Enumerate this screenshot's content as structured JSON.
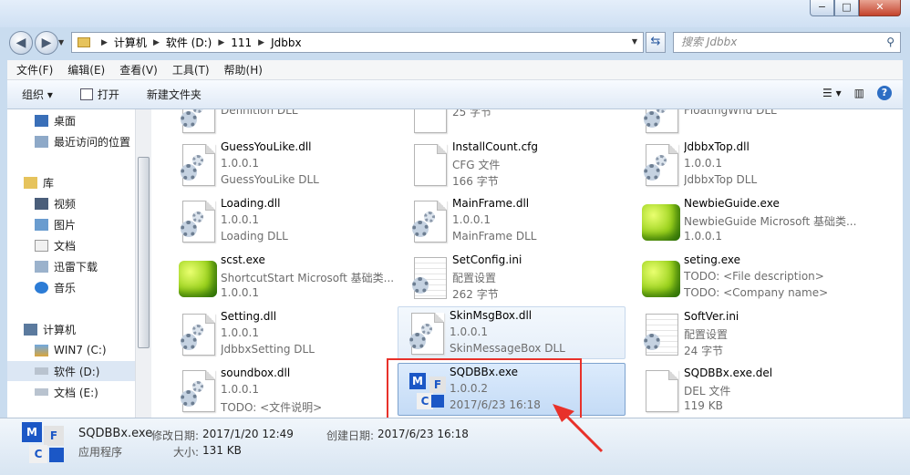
{
  "window": {
    "minimize": "−",
    "maximize": "□",
    "close": "✕"
  },
  "nav": {
    "back": "◀",
    "forward": "▶"
  },
  "address": {
    "crumbs": [
      "计算机",
      "软件 (D:)",
      "111",
      "Jdbbx"
    ]
  },
  "search": {
    "placeholder": "搜索 Jdbbx"
  },
  "menu": [
    "文件(F)",
    "编辑(E)",
    "查看(V)",
    "工具(T)",
    "帮助(H)"
  ],
  "toolbar": {
    "organize": "组织 ▾",
    "open": "打开",
    "new_folder": "新建文件夹"
  },
  "sidebar": {
    "items": [
      {
        "label": "桌面",
        "icon": "desktop-icon"
      },
      {
        "label": "最近访问的位置",
        "icon": "recent-places-icon"
      },
      {
        "label": "库",
        "icon": "library-icon"
      },
      {
        "label": "视频",
        "icon": "video-icon"
      },
      {
        "label": "图片",
        "icon": "pictures-icon"
      },
      {
        "label": "文档",
        "icon": "documents-icon"
      },
      {
        "label": "迅雷下载",
        "icon": "thunder-download-icon"
      },
      {
        "label": "音乐",
        "icon": "music-icon"
      },
      {
        "label": "计算机",
        "icon": "computer-icon"
      },
      {
        "label": "WIN7 (C:)",
        "icon": "drive-c-icon"
      },
      {
        "label": "软件 (D:)",
        "icon": "drive-d-icon"
      },
      {
        "label": "文档 (E:)",
        "icon": "drive-e-icon"
      }
    ]
  },
  "files": [
    {
      "name": "",
      "l2": "Definition DLL",
      "l3": "",
      "icon": "dll"
    },
    {
      "name": "",
      "l2": "25 字节",
      "l3": "",
      "icon": "doc"
    },
    {
      "name": "",
      "l2": "FloatingWnd DLL",
      "l3": "",
      "icon": "dll"
    },
    {
      "name": "GuessYouLike.dll",
      "l2": "1.0.0.1",
      "l3": "GuessYouLike DLL",
      "icon": "dll"
    },
    {
      "name": "InstallCount.cfg",
      "l2": "CFG 文件",
      "l3": "166 字节",
      "icon": "doc"
    },
    {
      "name": "JdbbxTop.dll",
      "l2": "1.0.0.1",
      "l3": "JdbbxTop DLL",
      "icon": "dll"
    },
    {
      "name": "Loading.dll",
      "l2": "1.0.0.1",
      "l3": "Loading DLL",
      "icon": "dll"
    },
    {
      "name": "MainFrame.dll",
      "l2": "1.0.0.1",
      "l3": "MainFrame DLL",
      "icon": "dll"
    },
    {
      "name": "NewbieGuide.exe",
      "l2": "NewbieGuide Microsoft 基础类...",
      "l3": "1.0.0.1",
      "icon": "cube"
    },
    {
      "name": "scst.exe",
      "l2": "ShortcutStart Microsoft 基础类...",
      "l3": "1.0.0.1",
      "icon": "cube"
    },
    {
      "name": "SetConfig.ini",
      "l2": "配置设置",
      "l3": "262 字节",
      "icon": "cfg"
    },
    {
      "name": "seting.exe",
      "l2": "TODO: <File description>",
      "l3": "TODO: <Company name>",
      "icon": "cube"
    },
    {
      "name": "Setting.dll",
      "l2": "1.0.0.1",
      "l3": "JdbbxSetting DLL",
      "icon": "dll"
    },
    {
      "name": "SkinMsgBox.dll",
      "l2": "1.0.0.1",
      "l3": "SkinMessageBox DLL",
      "icon": "dll"
    },
    {
      "name": "SoftVer.ini",
      "l2": "配置设置",
      "l3": "24 字节",
      "icon": "cfg"
    },
    {
      "name": "soundbox.dll",
      "l2": "1.0.0.1",
      "l3": "TODO: <文件说明>",
      "icon": "dll"
    },
    {
      "name": "SQDBBx.exe",
      "l2": "1.0.0.2",
      "l3": "2017/6/23 16:18",
      "icon": "mfc"
    },
    {
      "name": "SQDBBx.exe.del",
      "l2": "DEL 文件",
      "l3": "119 KB",
      "icon": "doc"
    }
  ],
  "status": {
    "name": "SQDBBx.exe",
    "modified_label": "修改日期:",
    "modified": "2017/1/20 12:49",
    "created_label": "创建日期:",
    "created": "2017/6/23 16:18",
    "type": "应用程序",
    "size_label": "大小:",
    "size": "131 KB"
  },
  "colors": {
    "selection_border": "#e8312a",
    "arrow": "#e8312a"
  }
}
